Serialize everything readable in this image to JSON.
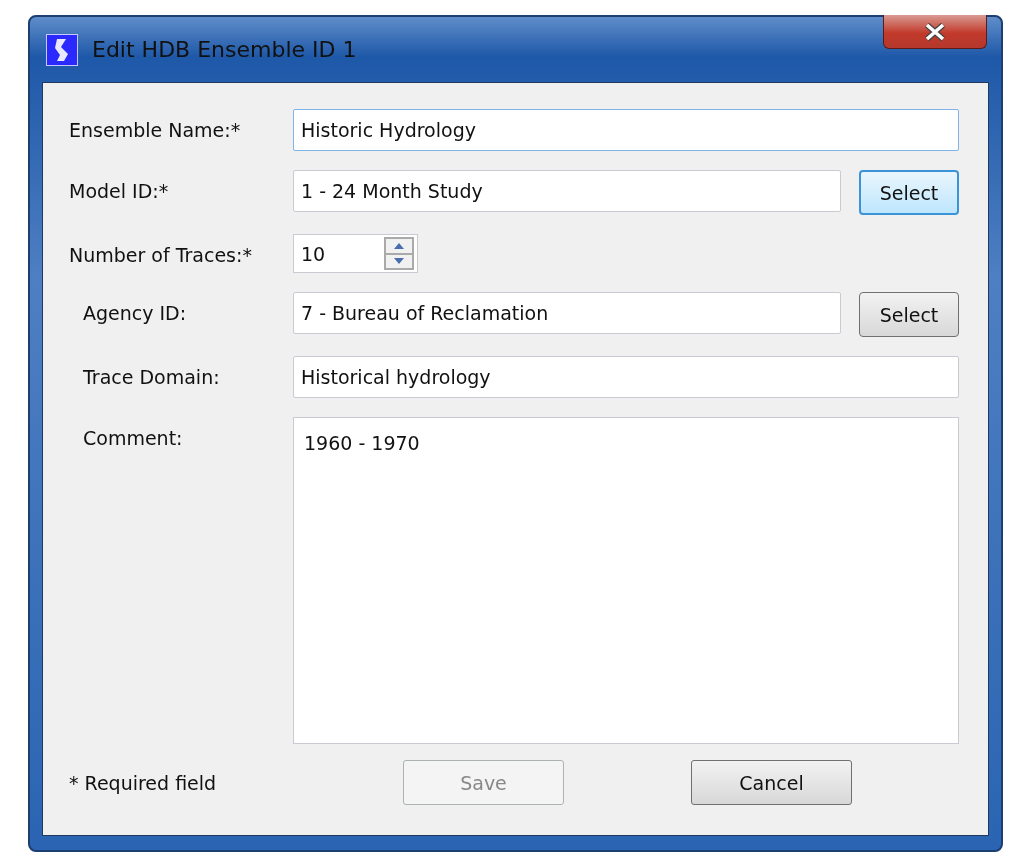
{
  "window": {
    "title": "Edit HDB Ensemble ID 1"
  },
  "fields": [
    {
      "kind": "text",
      "label": "Ensemble Name:*",
      "required": true,
      "value": "Historic Hydrology",
      "focused": true
    },
    {
      "kind": "select",
      "label": "Model ID:*",
      "required": true,
      "value": "1 - 24 Month Study",
      "button": "Select",
      "button_focused": true
    },
    {
      "kind": "spinner",
      "label": "Number of Traces:*",
      "required": true,
      "value": "10"
    },
    {
      "kind": "select",
      "label": "Agency ID:",
      "required": false,
      "value": "7 - Bureau of Reclamation",
      "button": "Select",
      "button_focused": false
    },
    {
      "kind": "text",
      "label": "Trace Domain:",
      "required": false,
      "value": "Historical hydrology",
      "focused": false
    },
    {
      "kind": "textarea",
      "label": "Comment:",
      "required": false,
      "value": "1960 - 1970"
    }
  ],
  "footer": {
    "note": "* Required field",
    "buttons": [
      {
        "label": "Save",
        "disabled": true
      },
      {
        "label": "Cancel",
        "disabled": false
      }
    ]
  }
}
